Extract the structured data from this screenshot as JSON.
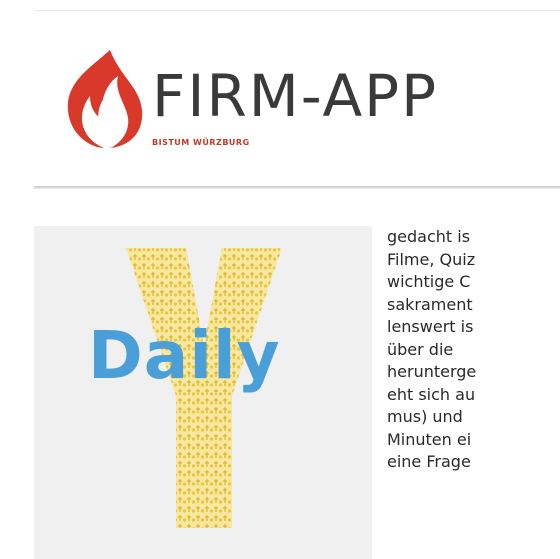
{
  "header": {
    "brand": "FIRM-APP",
    "subtitle": "BISTUM WÜRZBURG",
    "flame_color": "#d9392b"
  },
  "thumbnail": {
    "word": "Daily",
    "letter": "Y",
    "word_color": "#4a9fd8",
    "letter_color": "#e8c73a"
  },
  "article": {
    "lines": [
      "gedacht is",
      "Filme, Quiz",
      "wichtige C",
      "sakrament",
      "lenswert is",
      "über die",
      "herunterge",
      "eht sich au",
      "mus) und",
      "Minuten ei",
      "eine Frage"
    ]
  }
}
